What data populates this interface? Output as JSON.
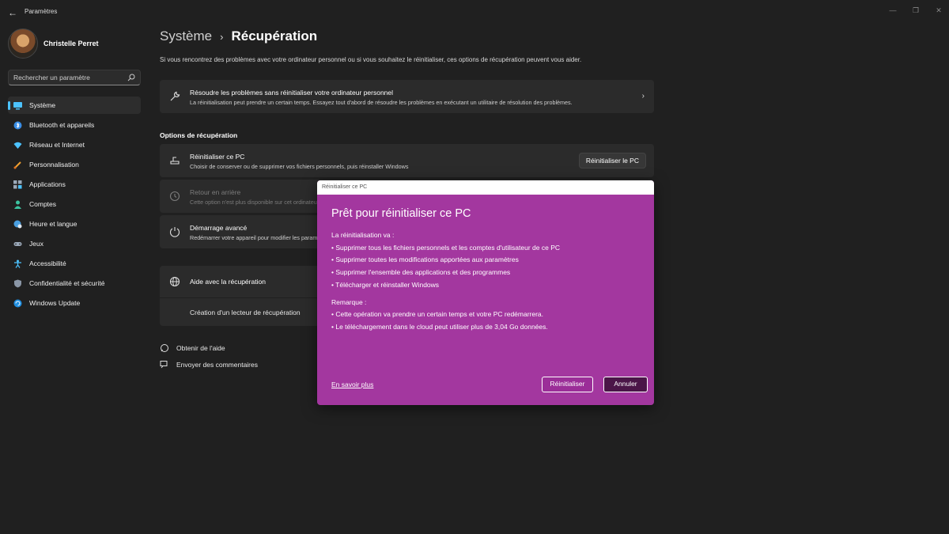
{
  "app": {
    "title": "Paramètres",
    "back_icon": "arrow-left-icon"
  },
  "profile": {
    "name": "Christelle Perret"
  },
  "search": {
    "placeholder": "Rechercher un paramètre"
  },
  "sidebar": {
    "items": [
      {
        "label": "Système",
        "icon": "system-icon",
        "active": true
      },
      {
        "label": "Bluetooth et appareils",
        "icon": "bluetooth-icon"
      },
      {
        "label": "Réseau et Internet",
        "icon": "wifi-icon"
      },
      {
        "label": "Personnalisation",
        "icon": "brush-icon"
      },
      {
        "label": "Applications",
        "icon": "apps-icon"
      },
      {
        "label": "Comptes",
        "icon": "account-icon"
      },
      {
        "label": "Heure et langue",
        "icon": "globe-clock-icon"
      },
      {
        "label": "Jeux",
        "icon": "gamepad-icon"
      },
      {
        "label": "Accessibilité",
        "icon": "accessibility-icon"
      },
      {
        "label": "Confidentialité et sécurité",
        "icon": "shield-icon"
      },
      {
        "label": "Windows Update",
        "icon": "update-icon"
      }
    ]
  },
  "main": {
    "breadcrumb_parent": "Système",
    "breadcrumb_current": "Récupération",
    "intro": "Si vous rencontrez des problèmes avec votre ordinateur personnel ou si vous souhaitez le réinitialiser, ces options de récupération peuvent vous aider.",
    "troubleshoot": {
      "title": "Résoudre les problèmes sans réinitialiser votre ordinateur personnel",
      "desc": "La réinitialisation peut prendre un certain temps. Essayez tout d'abord de résoudre les problèmes en exécutant un utilitaire de résolution des problèmes."
    },
    "section_label": "Options de récupération",
    "reset_pc": {
      "title": "Réinitialiser ce PC",
      "desc": "Choisir de conserver ou de supprimer vos fichiers personnels, puis réinstaller Windows",
      "button": "Réinitialiser le PC"
    },
    "go_back": {
      "title": "Retour en arrière",
      "desc": "Cette option n'est plus disponible sur cet ordinateur"
    },
    "advanced_startup": {
      "title": "Démarrage avancé",
      "desc": "Redémarrer votre appareil pour modifier les paramètres de démarrage"
    },
    "help": {
      "title": "Aide avec la récupération",
      "link": "Création d'un lecteur de récupération"
    },
    "footer": {
      "get_help": "Obtenir de l'aide",
      "feedback": "Envoyer des commentaires"
    }
  },
  "dialog": {
    "window_title": "Réinitialiser ce PC",
    "heading": "Prêt pour réinitialiser ce PC",
    "intro": "La réinitialisation va :",
    "items": [
      "•  Supprimer tous les fichiers personnels et les comptes d'utilisateur de ce PC",
      "•  Supprimer toutes les modifications apportées aux paramètres",
      "•  Supprimer l'ensemble des applications et des programmes",
      "• Télécharger et réinstaller Windows"
    ],
    "note_label": "Remarque :",
    "notes": [
      "• Cette opération va prendre un certain temps et votre PC redémarrera.",
      "• Le téléchargement dans le cloud peut utiliser plus de 3,04 Go données."
    ],
    "learn_more": "En savoir plus",
    "reset_button": "Réinitialiser",
    "cancel_button": "Annuler",
    "accent_color": "#a3379f"
  }
}
